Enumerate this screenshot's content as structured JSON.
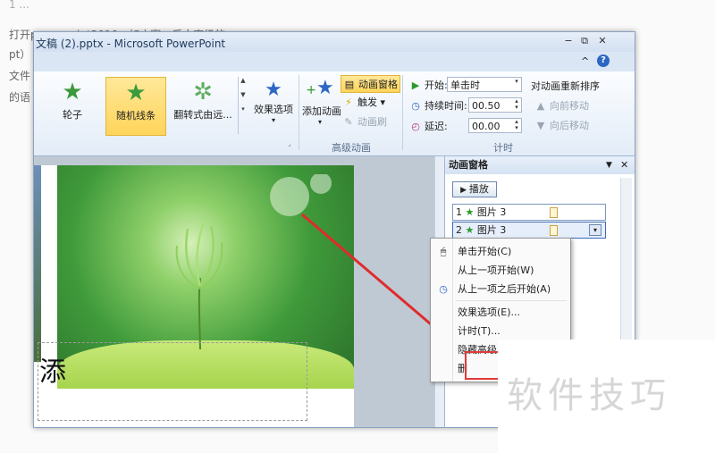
{
  "article": {
    "lines": [
      "打开powerpoint2010，如方案，后文高级的e",
      "pt）",
      "文件",
      "的语"
    ]
  },
  "window": {
    "title": "文稿 (2).pptx - Microsoft PowerPoint",
    "minimize": "−",
    "restore": "⧉",
    "close": "✕",
    "collapse_ribbon": "^",
    "help": "?"
  },
  "ribbon": {
    "gallery": [
      {
        "label": "轮子",
        "icon": "star-green-icon"
      },
      {
        "label": "随机线条",
        "icon": "star-green-icon",
        "selected": true
      },
      {
        "label": "翻转式由远...",
        "icon": "star-burst-icon"
      }
    ],
    "effect_options": "效果选项",
    "add_animation": "添加动画",
    "animation_pane": "动画窗格",
    "trigger": "触发",
    "animation_painter": "动画刷",
    "advanced_group": "高级动画",
    "start_label": "开始:",
    "start_value": "单击时",
    "duration_label": "持续时间:",
    "duration_value": "00.50",
    "delay_label": "延迟:",
    "delay_value": "00.00",
    "timing_group": "计时",
    "reorder_title": "对动画重新排序",
    "move_earlier": "向前移动",
    "move_later": "向后移动"
  },
  "slide": {
    "partial_char": "添"
  },
  "pane": {
    "title": "动画窗格",
    "play": "播放",
    "items": [
      {
        "num": "1",
        "name": "图片 3"
      },
      {
        "num": "2",
        "name": "图片 3"
      }
    ]
  },
  "menu": {
    "items": [
      {
        "label": "单击开始(C)",
        "icon": "mouse-icon"
      },
      {
        "label": "从上一项开始(W)",
        "icon": ""
      },
      {
        "label": "从上一项之后开始(A)",
        "icon": "clock-icon"
      },
      {
        "label": "效果选项(E)...",
        "icon": ""
      },
      {
        "label": "计时(T)...",
        "icon": ""
      },
      {
        "label": "隐藏高级日程表(H)",
        "icon": ""
      },
      {
        "label": "删",
        "icon": ""
      }
    ]
  },
  "watermark": "软件技巧"
}
